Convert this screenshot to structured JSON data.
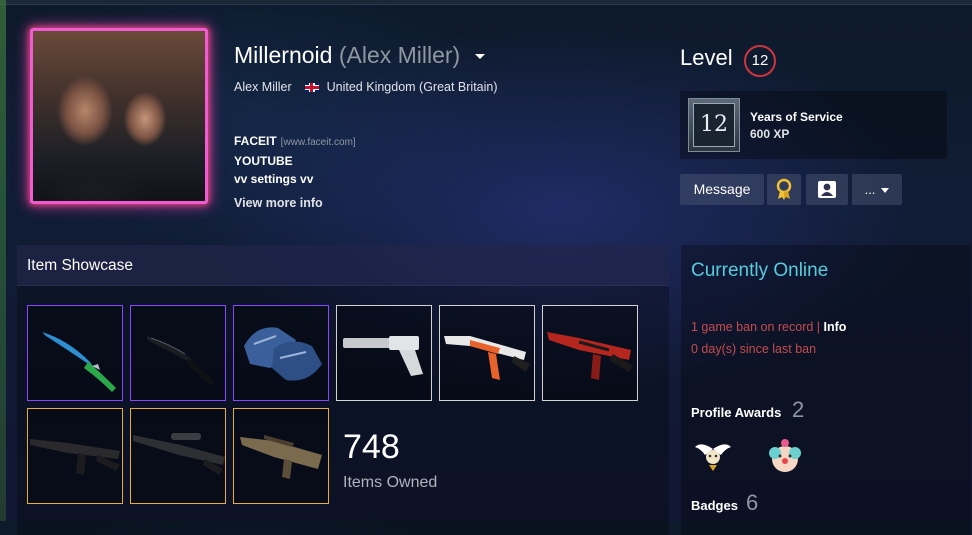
{
  "profile": {
    "persona_name": "Millernoid",
    "real_name": "(Alex Miller)",
    "real_name_plain": "Alex Miller",
    "country": "United Kingdom (Great Britain)",
    "summary": {
      "line1": "FACEIT",
      "line1_small": "[www.faceit.com]",
      "line2": "YOUTUBE",
      "line3": "vv settings vv"
    },
    "view_more": "View more info"
  },
  "level": {
    "label": "Level",
    "value": "12"
  },
  "favorite_badge": {
    "icon_text": "12",
    "title": "Years of Service",
    "xp": "600 XP"
  },
  "actions": {
    "message": "Message",
    "more": "..."
  },
  "showcase": {
    "title": "Item Showcase",
    "count": "748",
    "count_label": "Items Owned",
    "items": [
      {
        "name": "butterfly-knife",
        "rarity": "purple"
      },
      {
        "name": "shadow-daggers",
        "rarity": "purple"
      },
      {
        "name": "gloves",
        "rarity": "purple"
      },
      {
        "name": "usp-s",
        "rarity": "white"
      },
      {
        "name": "ak-47-asiimov",
        "rarity": "white"
      },
      {
        "name": "m4a4-red",
        "rarity": "white"
      },
      {
        "name": "m4a1-s",
        "rarity": "gold"
      },
      {
        "name": "awp",
        "rarity": "gold"
      },
      {
        "name": "famas",
        "rarity": "gold"
      }
    ]
  },
  "status": {
    "online": "Currently Online",
    "ban_text": "1 game ban on record |",
    "ban_info": "Info",
    "ban_days": "0 day(s) since last ban",
    "awards_label": "Profile Awards",
    "awards_count": "2",
    "badges_label": "Badges",
    "badges_count": "6"
  },
  "colors": {
    "online": "#57cbde",
    "ban": "#c34d4d",
    "level_ring": "#d0343c",
    "rarity_purple": "#8847ff",
    "rarity_gold": "#e4ae39"
  }
}
